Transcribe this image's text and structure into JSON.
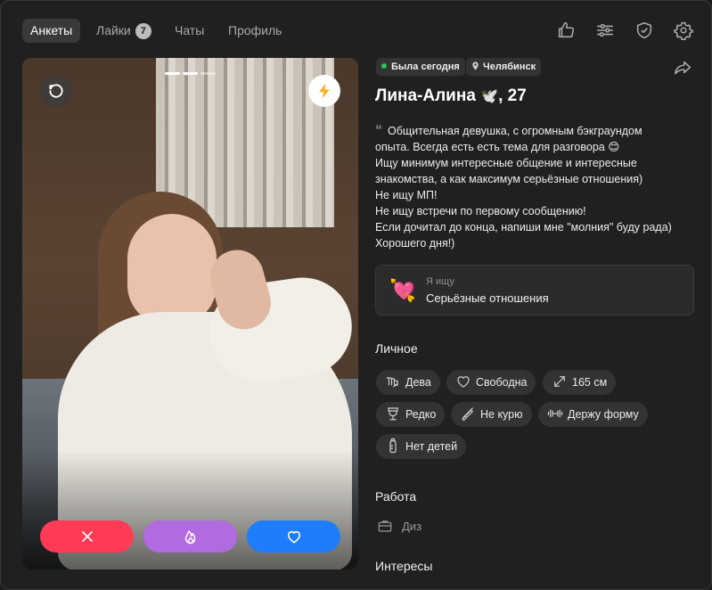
{
  "nav": {
    "tabs": [
      {
        "label": "Анкеты",
        "active": true
      },
      {
        "label": "Лайки",
        "count": "7"
      },
      {
        "label": "Чаты"
      },
      {
        "label": "Профиль"
      }
    ],
    "icons": [
      "thumbs-up-icon",
      "sliders-icon",
      "shield-check-icon",
      "gear-icon"
    ]
  },
  "photo": {
    "progress_segments": 3,
    "active_segment": 2,
    "undo_icon": "undo-icon",
    "boost_icon": "lightning-icon",
    "actions": [
      "dislike-x-icon",
      "superlike-flame-icon",
      "like-heart-icon"
    ]
  },
  "profile": {
    "status": "Была сегодня",
    "city": "Челябинск",
    "name": "Лина-Алина",
    "name_emoji": "🕊️",
    "age": ", 27",
    "bio_lines": [
      "Общительная девушка, с огромным бэкграундом",
      "опыта. Всегда есть есть тема для разговора 😊",
      "Ищу минимум интересные общение и интересные",
      "знакомства, а как максимум серьёзные отношения)",
      "Не ищу МП!",
      "Не ищу встречи по первому сообщению!",
      "Если дочитал до конца, напиши мне \"молния\" буду рада)",
      "Хорошего дня!)"
    ],
    "looking_caption": "Я ищу",
    "looking_value": "Серьёзные отношения",
    "personal_title": "Личное",
    "tags": [
      {
        "icon": "virgo-icon",
        "label": "Дева"
      },
      {
        "icon": "heart-outline-icon",
        "label": "Свободна"
      },
      {
        "icon": "height-arrows-icon",
        "label": "165 см"
      },
      {
        "icon": "wine-glass-icon",
        "label": "Редко"
      },
      {
        "icon": "no-smoking-icon",
        "label": "Не курю"
      },
      {
        "icon": "dumbbell-icon",
        "label": "Держу форму"
      },
      {
        "icon": "baby-bottle-icon",
        "label": "Нет детей"
      }
    ],
    "work_title": "Работа",
    "work_value": "Диз",
    "interests_title": "Интересы"
  },
  "colors": {
    "accent_green": "#33c252",
    "dislike": "#ff3b55",
    "superlike": "#b16ae0",
    "like": "#1d7dfa",
    "boost": "#ffb21f"
  }
}
